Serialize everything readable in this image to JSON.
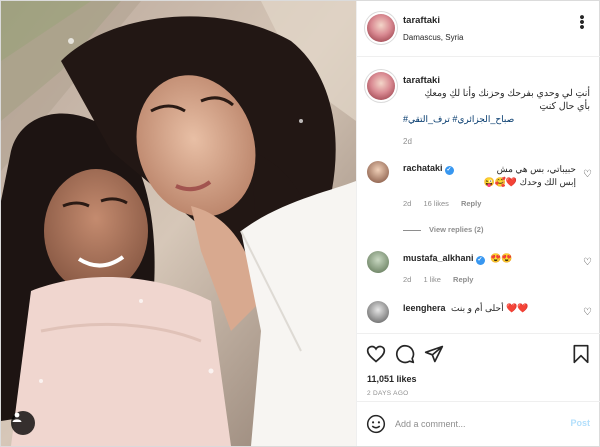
{
  "post": {
    "username": "taraftaki",
    "location": "Damascus, Syria",
    "caption_text": "أنتِ لي وحدي بفرحك وحزنك وأنا لكِ ومعكِ بأي حال كنتِ",
    "caption_tags": "صباح_الجزائري# ترف_التقي#",
    "caption_time": "2d",
    "likes": "11,051 likes",
    "posted_ago": "2 DAYS AGO"
  },
  "comments": [
    {
      "username": "rachataki",
      "verified": true,
      "text": "حبيباتي، بس هي مش إبس الك وحدك ❤️🥰😜",
      "time": "2d",
      "likes": "16 likes",
      "reply_label": "Reply",
      "view_replies": "View replies (2)"
    },
    {
      "username": "mustafa_alkhani",
      "verified": true,
      "text": "😍😍",
      "time": "2d",
      "likes": "1 like",
      "reply_label": "Reply"
    },
    {
      "username": "leenghera",
      "verified": false,
      "text": "أحلى أم و بنت ❤️❤️",
      "time": "",
      "likes": "",
      "reply_label": ""
    }
  ],
  "add_comment": {
    "placeholder": "Add a comment...",
    "post_label": "Post"
  },
  "icons": {
    "more": "more-icon",
    "like": "heart-icon",
    "comment": "comment-icon",
    "share": "share-icon",
    "save": "bookmark-icon",
    "emoji": "smiley-icon",
    "tag": "user-tag-icon"
  },
  "colors": {
    "link": "#00376b",
    "verified": "#3897f0",
    "post_disabled": "#b2dffc",
    "meta_gray": "#8e8e8e"
  }
}
